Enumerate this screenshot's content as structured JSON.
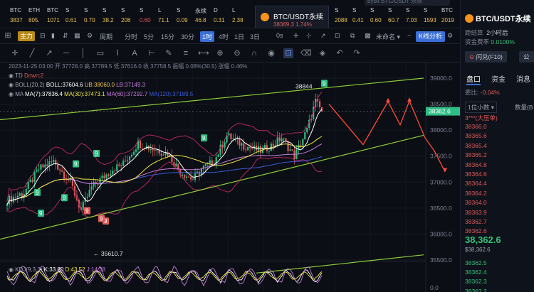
{
  "search_placeholder": "bybit BTC/USDT 永续",
  "top_tabs": [
    {
      "name": "BTC",
      "price": "3837",
      "dir": "up"
    },
    {
      "name": "ETH",
      "price": "805.",
      "dir": "up"
    },
    {
      "name": "BTC",
      "price": "1071",
      "dir": "up"
    },
    {
      "name": "S",
      "price": "0.61",
      "dir": "up"
    },
    {
      "name": "S",
      "price": "0.70",
      "dir": "up"
    },
    {
      "name": "S",
      "price": "38.2",
      "dir": "up"
    },
    {
      "name": "S",
      "price": "208",
      "dir": "up"
    },
    {
      "name": "S",
      "price": "0.60",
      "dir": "down"
    },
    {
      "name": "L",
      "price": "71.1",
      "dir": "up"
    },
    {
      "name": "S",
      "price": "0.09",
      "dir": "up"
    },
    {
      "name": "永续",
      "price": "46.8",
      "dir": "up"
    },
    {
      "name": "D",
      "price": "0.31",
      "dir": "up"
    },
    {
      "name": "L",
      "price": "2.38",
      "dir": "up"
    }
  ],
  "active_tab": {
    "name": "BTC/USDT永续",
    "price": "38369.3",
    "change": "1.74%"
  },
  "right_tabs": [
    {
      "name": "S",
      "price": "2088"
    },
    {
      "name": "S",
      "price": "0.41"
    },
    {
      "name": "S",
      "price": "0.60"
    },
    {
      "name": "S",
      "price": "60.7"
    },
    {
      "name": "S",
      "price": "7.03"
    },
    {
      "name": "S",
      "price": "1593"
    },
    {
      "name": "BTC",
      "price": "2019"
    }
  ],
  "toolbar": {
    "main": "主力",
    "period": "周期",
    "intervals": [
      "分时",
      "5分",
      "15分",
      "30分",
      "1时",
      "4时",
      "1日",
      "3日"
    ],
    "selected_interval": "1时",
    "zero_s": "0s",
    "unnamed": "未命名",
    "k_analysis": "K线分析"
  },
  "draw_icons": [
    "crosshair-icon",
    "line-icon",
    "ray-icon",
    "hline-icon",
    "vline-icon",
    "rect-icon",
    "path-icon",
    "text-icon",
    "ruler-icon",
    "brush-icon",
    "fib-icon",
    "measure-icon",
    "zoom-in-icon",
    "zoom-out-icon",
    "magnet-icon",
    "eye-icon",
    "lock-icon",
    "trash-icon",
    "layer-icon",
    "undo-icon",
    "redo-icon"
  ],
  "legend": {
    "date": "2023-11-25 03:00",
    "open": "开 37728.0",
    "high": "高 37789.5",
    "low": "低 37616.0",
    "close": "收 37758.5",
    "amp": "振幅 0.08%(30.5)",
    "change": "涨幅 0.46%",
    "td": "TD",
    "td_value": "Down:2",
    "boll": "BOLL(20,2)",
    "boll_mid": "BOLL:37604.6",
    "boll_ub": "UB:38060.0",
    "boll_lb": "LB:37149.3",
    "ma": "MA",
    "ma7": "MA(7):37836.4",
    "ma30": "MA(30):37473.1",
    "ma60": "MA(60):37292.7",
    "ma120": "MA(120):37189.5",
    "kdj": "KDJ(9,3,3)",
    "kdj_k": "K:33.80",
    "kdj_d": "D:43.52",
    "kdj_j": "J:14.38"
  },
  "chart_data": {
    "type": "candlestick",
    "y_ticks": [
      39000,
      38500,
      38000,
      37500,
      37000,
      36500,
      36000,
      35500,
      0
    ],
    "current_price": "38362.6",
    "peak_label": "38844",
    "trough_label": "35610.7",
    "td_markers": [
      {
        "label": "9",
        "kind": "green"
      },
      {
        "label": "9",
        "kind": "green"
      },
      {
        "label": "9",
        "kind": "green"
      },
      {
        "label": "9",
        "kind": "green"
      },
      {
        "label": "9",
        "kind": "green"
      },
      {
        "label": "9",
        "kind": "red"
      },
      {
        "label": "9",
        "kind": "red"
      },
      {
        "label": "9",
        "kind": "red"
      },
      {
        "label": "9",
        "kind": "green"
      },
      {
        "label": "9",
        "kind": "green"
      }
    ],
    "colors": {
      "up": "#2ebd85",
      "down": "#e05a5a",
      "boll": "#b3265f",
      "ma7": "#ffffff",
      "ma30": "#f0e442",
      "ma60": "#c77bdb",
      "ma120": "#3a5bd9",
      "trend": "#8ecf3a",
      "arrow": "#ff4a3a"
    }
  },
  "right_panel": {
    "title": "BTC/USDT永续",
    "dist_label": "距结算",
    "dist_value": "2小时后",
    "fee_label": "资金费率",
    "fee_value": "0.0100%",
    "btn_flash": "闪兑(F10)",
    "btn_other": "公",
    "tabs": [
      "盘口",
      "资金",
      "消息"
    ],
    "ratio_label": "委比:",
    "ratio_value": "-0.04%",
    "decimals": "1位小数",
    "qty": "数量(B",
    "sell_wall": "3***(大压单)",
    "sells": [
      "38366.0",
      "38365.6",
      "38365.4",
      "38365.2",
      "38364.8",
      "38364.6",
      "38364.4",
      "38364.2",
      "38364.0",
      "38363.9",
      "38362.7",
      "38362.6"
    ],
    "last_price": "38,362.6",
    "last_sub": "$38,362.6",
    "buys": [
      "38362.5",
      "38362.4",
      "38362.3",
      "38362.2",
      "38362.1"
    ]
  }
}
